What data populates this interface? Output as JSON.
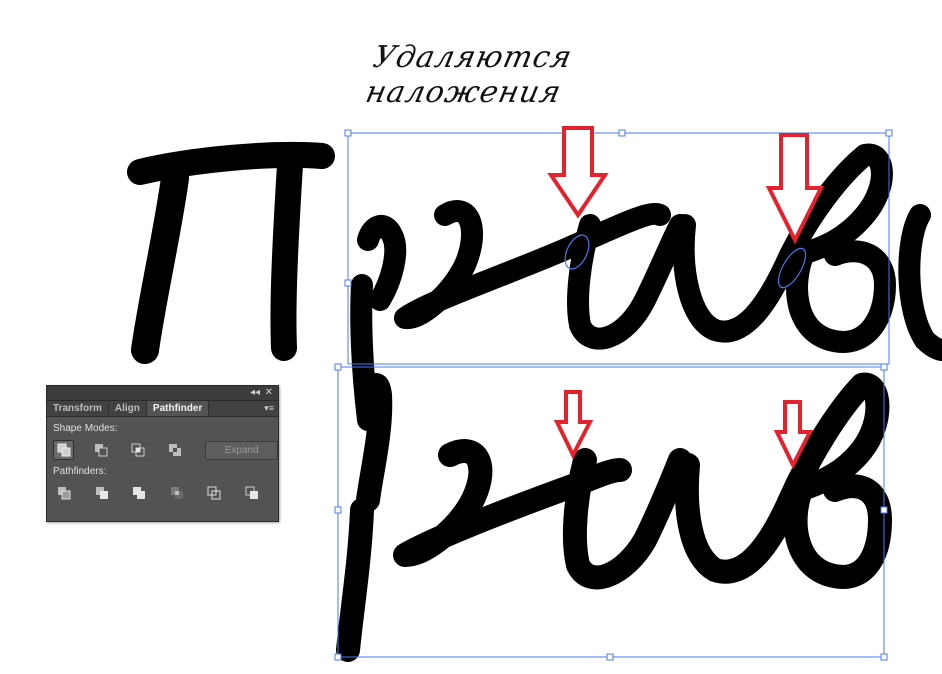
{
  "caption": {
    "text": "Удаляются наложения"
  },
  "panel": {
    "tabs": [
      {
        "label": "Transform",
        "active": false
      },
      {
        "label": "Align",
        "active": false
      },
      {
        "label": "Pathfinder",
        "active": true
      }
    ],
    "shape_modes_label": "Shape Modes:",
    "pathfinders_label": "Pathfinders:",
    "expand_label": "Expand",
    "collapse_glyph": "◂◂",
    "close_glyph": "✕",
    "menu_glyph": "▾≡"
  },
  "colors": {
    "arrow": "#e4222d",
    "selection": "#4a78f0",
    "stroke": "#000000",
    "panel_bg": "#535353"
  },
  "icons": [
    "unite-icon",
    "minus-front-icon",
    "intersect-icon",
    "exclude-icon",
    "divide-icon",
    "trim-icon",
    "merge-icon",
    "crop-icon",
    "outline-icon",
    "minus-back-icon"
  ]
}
